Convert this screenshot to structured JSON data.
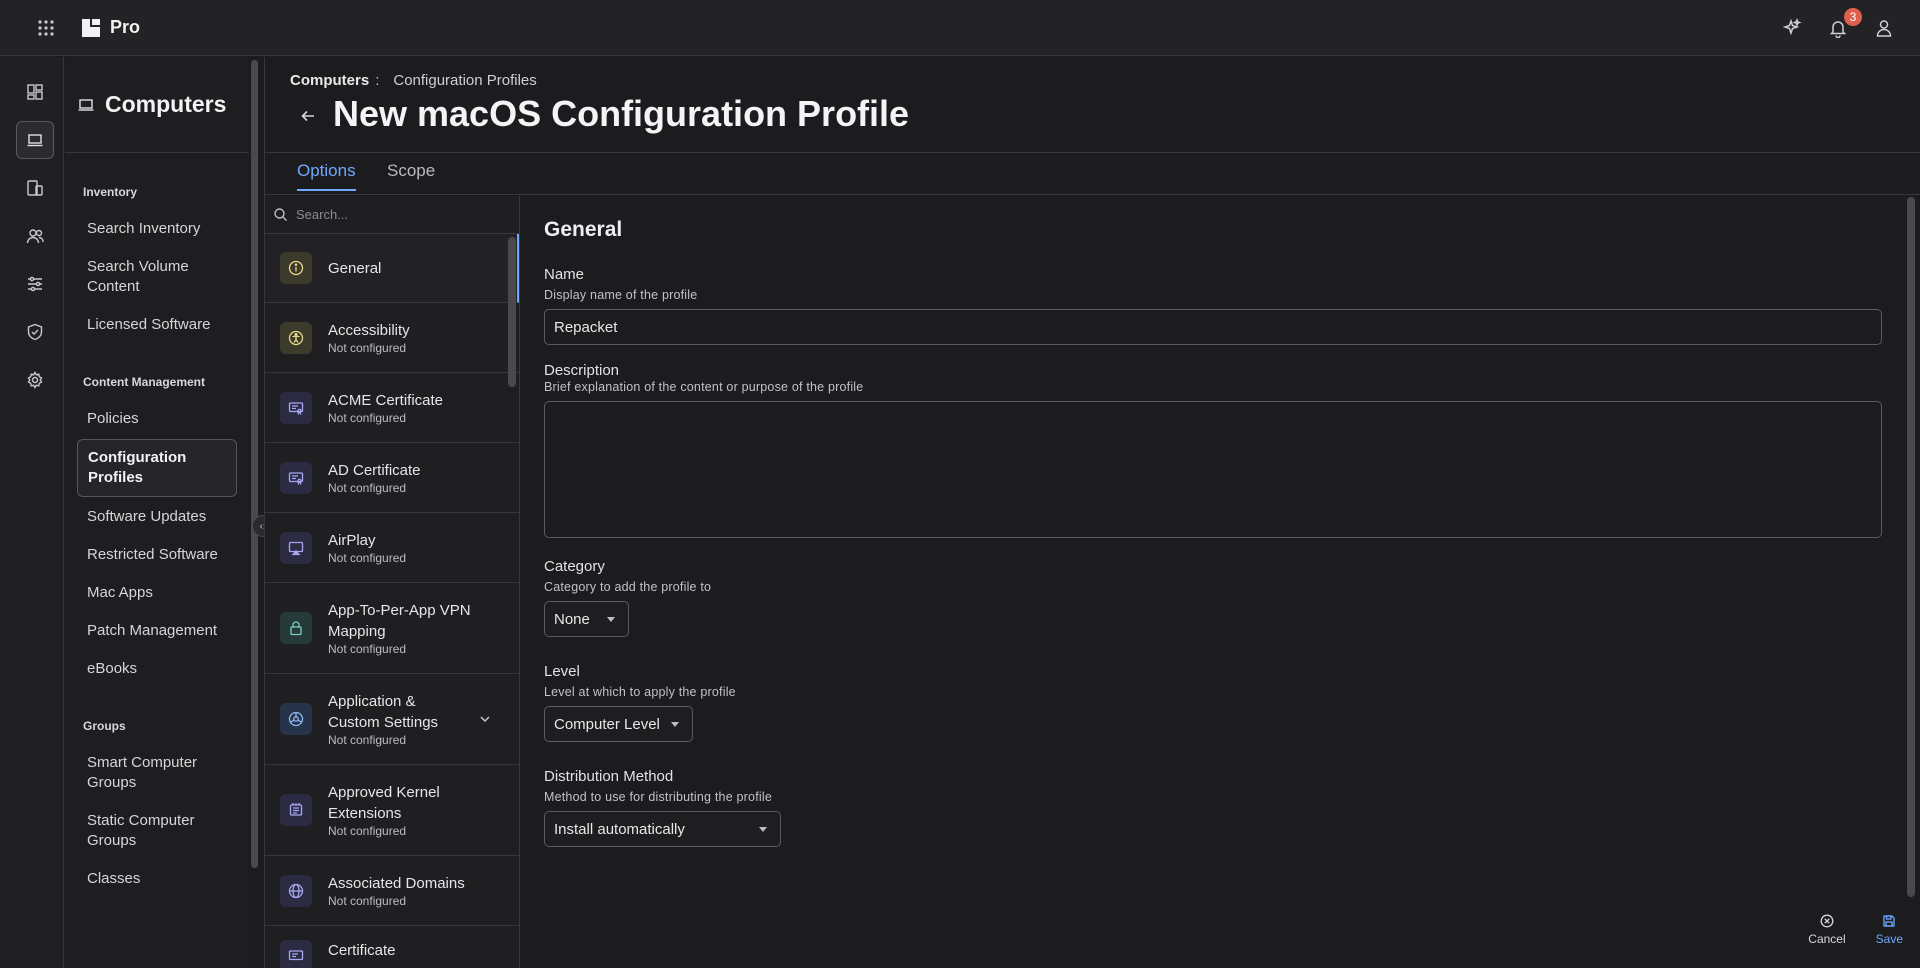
{
  "app": {
    "name": "Pro",
    "notification_count": "3"
  },
  "nav": {
    "title": "Computers",
    "sections": [
      {
        "label": "Inventory",
        "items": [
          "Search Inventory",
          "Search Volume Content",
          "Licensed Software"
        ]
      },
      {
        "label": "Content Management",
        "items": [
          "Policies",
          "Configuration Profiles",
          "Software Updates",
          "Restricted Software",
          "Mac Apps",
          "Patch Management",
          "eBooks"
        ]
      },
      {
        "label": "Groups",
        "items": [
          "Smart Computer Groups",
          "Static Computer Groups",
          "Classes"
        ]
      }
    ],
    "active_item": "Configuration Profiles"
  },
  "breadcrumb": {
    "parent": "Computers",
    "separator": ":",
    "current": "Configuration Profiles"
  },
  "page": {
    "title": "New macOS Configuration Profile"
  },
  "tabs": [
    {
      "label": "Options",
      "active": true
    },
    {
      "label": "Scope",
      "active": false
    }
  ],
  "payloads": {
    "search_placeholder": "Search...",
    "items": [
      {
        "name": "General",
        "status": "",
        "icon": "info-icon",
        "color": "yellow",
        "active": true
      },
      {
        "name": "Accessibility",
        "status": "Not configured",
        "icon": "accessibility-icon",
        "color": "yellow"
      },
      {
        "name": "ACME Certificate",
        "status": "Not configured",
        "icon": "certificate-icon",
        "color": "purple"
      },
      {
        "name": "AD Certificate",
        "status": "Not configured",
        "icon": "certificate-icon",
        "color": "purple"
      },
      {
        "name": "AirPlay",
        "status": "Not configured",
        "icon": "airplay-icon",
        "color": "purple"
      },
      {
        "name": "App-To-Per-App VPN Mapping",
        "status": "Not configured",
        "icon": "lock-icon",
        "color": "teal"
      },
      {
        "name": "Application & Custom Settings",
        "status": "Not configured",
        "icon": "gear-icon",
        "color": "blue",
        "expandable": true
      },
      {
        "name": "Approved Kernel Extensions",
        "status": "Not configured",
        "icon": "chip-icon",
        "color": "purple"
      },
      {
        "name": "Associated Domains",
        "status": "Not configured",
        "icon": "globe-icon",
        "color": "purple"
      },
      {
        "name": "Certificate",
        "status": "",
        "icon": "certificate-icon",
        "color": "purple"
      }
    ]
  },
  "form": {
    "section_title": "General",
    "name": {
      "label": "Name",
      "hint": "Display name of the profile",
      "value": "Repacket"
    },
    "description": {
      "label": "Description",
      "hint": "Brief explanation of the content or purpose of the profile",
      "value": ""
    },
    "category": {
      "label": "Category",
      "hint": "Category to add the profile to",
      "value": "None"
    },
    "level": {
      "label": "Level",
      "hint": "Level at which to apply the profile",
      "value": "Computer Level"
    },
    "distribution": {
      "label": "Distribution Method",
      "hint": "Method to use for distributing the profile",
      "value": "Install automatically"
    }
  },
  "actions": {
    "cancel": "Cancel",
    "save": "Save"
  },
  "colors": {
    "accent": "#6fa8ff",
    "badge": "#e0604f",
    "background": "#1c1c1e"
  }
}
